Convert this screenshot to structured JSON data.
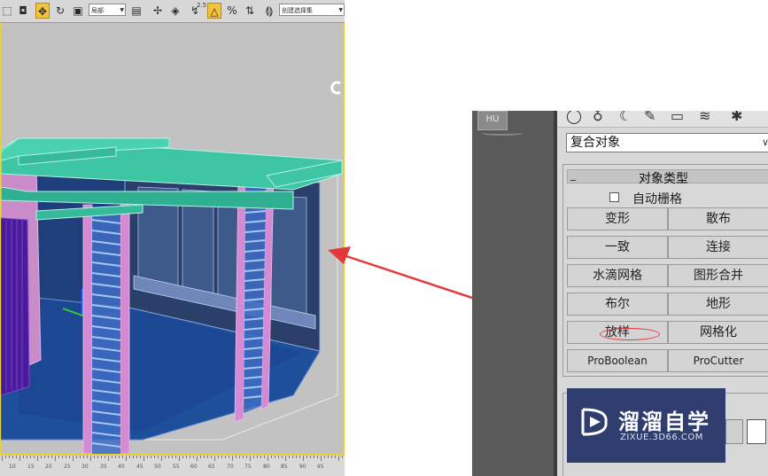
{
  "toolbar": {
    "coord_dropdown": "局部",
    "selection_set_placeholder": "创建选择集",
    "snap_badge": "2.5",
    "tools": [
      "select-region-icon",
      "select-center-icon",
      "move-icon",
      "rotate-icon",
      "scale-icon",
      "mirror-icon",
      "align-icon",
      "angle-snap-icon",
      "percent-snap-icon",
      "spinner-snap-icon",
      "named-selection-icon"
    ]
  },
  "ruler": {
    "ticks": [
      "10",
      "15",
      "20",
      "25",
      "30",
      "35",
      "40",
      "45",
      "50",
      "55",
      "60",
      "65",
      "70",
      "75",
      "80",
      "85",
      "90",
      "95"
    ]
  },
  "command_panel": {
    "category_dropdown": "复合对象",
    "rollout_title": "对象类型",
    "autogrid_label": "自动栅格",
    "buttons": [
      {
        "left": "变形",
        "right": "散布"
      },
      {
        "left": "一致",
        "right": "连接"
      },
      {
        "left": "水滴网格",
        "right": "图形合并"
      },
      {
        "left": "布尔",
        "right": "地形"
      },
      {
        "left": "放样",
        "right": "网格化"
      },
      {
        "left": "ProBoolean",
        "right": "ProCutter"
      }
    ],
    "highlighted_button": "放样"
  },
  "watermark": {
    "title": "溜溜自学",
    "url": "ZIXUE.3D66.COM"
  },
  "colors": {
    "accent_yellow": "#f3c43a",
    "viewport_border": "#e8d23a",
    "annotation_red": "#e23a3a",
    "watermark_bg": "#2f3e6e"
  }
}
